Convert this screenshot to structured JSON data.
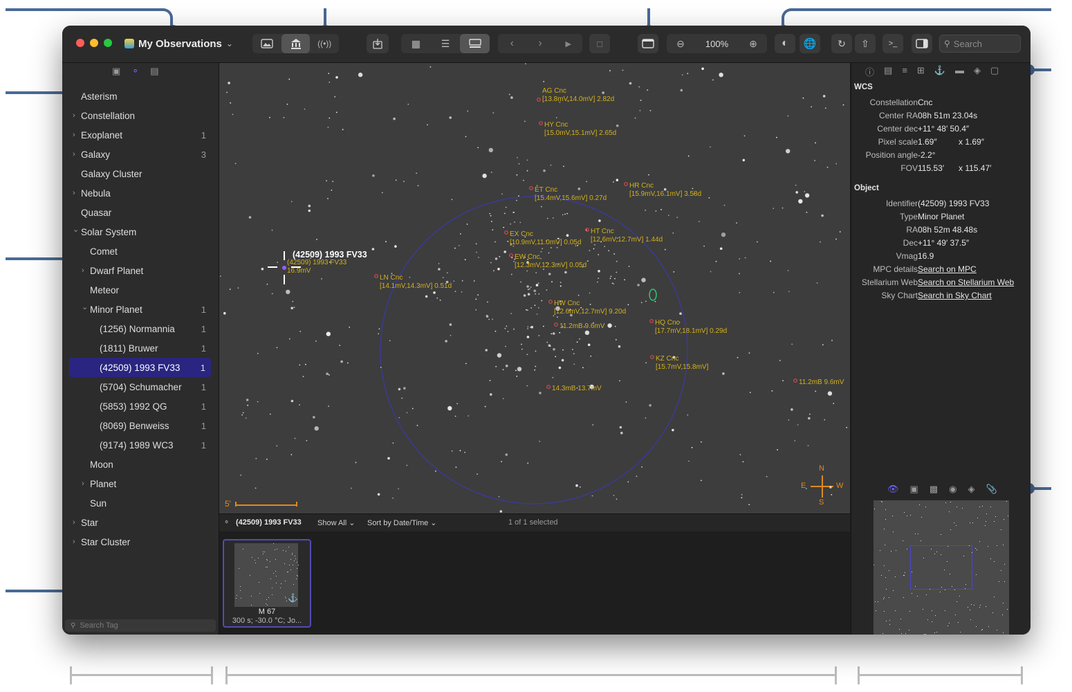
{
  "window": {
    "title": "My Observations",
    "zoom": "100%",
    "search_placeholder": "Search"
  },
  "sidebar": {
    "items": [
      {
        "label": "Asterism",
        "count": "",
        "expand": "none",
        "level": 0
      },
      {
        "label": "Constellation",
        "count": "",
        "expand": "collapsed",
        "level": 0
      },
      {
        "label": "Exoplanet",
        "count": "1",
        "expand": "collapsed",
        "level": 0
      },
      {
        "label": "Galaxy",
        "count": "3",
        "expand": "collapsed",
        "level": 0
      },
      {
        "label": "Galaxy Cluster",
        "count": "",
        "expand": "none",
        "level": 0
      },
      {
        "label": "Nebula",
        "count": "",
        "expand": "collapsed",
        "level": 0
      },
      {
        "label": "Quasar",
        "count": "",
        "expand": "none",
        "level": 0
      },
      {
        "label": "Solar System",
        "count": "",
        "expand": "expanded",
        "level": 0
      },
      {
        "label": "Comet",
        "count": "",
        "expand": "none",
        "level": 1
      },
      {
        "label": "Dwarf Planet",
        "count": "",
        "expand": "collapsed",
        "level": 1
      },
      {
        "label": "Meteor",
        "count": "",
        "expand": "none",
        "level": 1
      },
      {
        "label": "Minor Planet",
        "count": "1",
        "expand": "expanded",
        "level": 1
      },
      {
        "label": "(1256) Normannia",
        "count": "1",
        "expand": "none",
        "level": 2
      },
      {
        "label": "(1811) Bruwer",
        "count": "1",
        "expand": "none",
        "level": 2
      },
      {
        "label": "(42509) 1993 FV33",
        "count": "1",
        "expand": "none",
        "level": 2,
        "selected": true
      },
      {
        "label": "(5704) Schumacher",
        "count": "1",
        "expand": "none",
        "level": 2
      },
      {
        "label": "(5853) 1992 QG",
        "count": "1",
        "expand": "none",
        "level": 2
      },
      {
        "label": "(8069) Benweiss",
        "count": "1",
        "expand": "none",
        "level": 2
      },
      {
        "label": "(9174) 1989 WC3",
        "count": "1",
        "expand": "none",
        "level": 2
      },
      {
        "label": "Moon",
        "count": "",
        "expand": "none",
        "level": 1
      },
      {
        "label": "Planet",
        "count": "",
        "expand": "collapsed",
        "level": 1
      },
      {
        "label": "Sun",
        "count": "",
        "expand": "none",
        "level": 1
      },
      {
        "label": "Star",
        "count": "",
        "expand": "collapsed",
        "level": 0
      },
      {
        "label": "Star Cluster",
        "count": "",
        "expand": "collapsed",
        "level": 0
      }
    ],
    "search_placeholder": "Search Tag"
  },
  "sky": {
    "labels": [
      {
        "name": "AG Cnc",
        "mag": "[13.8mV,14.0mV] 2.82d"
      },
      {
        "name": "HY Cnc",
        "mag": "[15.0mV,15.1mV] 2.65d"
      },
      {
        "name": "ET Cnc",
        "mag": "[15.4mV,15.6mV] 0.27d"
      },
      {
        "name": "HR Cnc",
        "mag": "[15.9mV,16.1mV] 3.58d"
      },
      {
        "name": "EX Cnc",
        "mag": "[10.9mV,11.0mV] 0.05d"
      },
      {
        "name": "HT Cnc",
        "mag": "[12.6mV,12.7mV] 1.44d"
      },
      {
        "name": "EW Cnc",
        "mag": "[12.3mV,12.3mV] 0.05d"
      },
      {
        "name": "LN Cnc",
        "mag": "[14.1mV,14.3mV] 0.51d"
      },
      {
        "name": "HW Cnc",
        "mag": "[12.6mV,12.7mV] 9.20d"
      },
      {
        "name": "",
        "mag": "11.2mB 9.6mV"
      },
      {
        "name": "HQ Cnc",
        "mag": "[17.7mV,18.1mV] 0.29d"
      },
      {
        "name": "KZ Cnc",
        "mag": "[15.7mV,15.8mV]"
      },
      {
        "name": "",
        "mag": "14.3mB 13.7mV"
      },
      {
        "name": "",
        "mag": "11.2mB 9.6mV"
      }
    ],
    "target_title": "(42509) 1993 FV33",
    "target_sub": "(42509) 1993 FV33",
    "target_mag": "16.9mV",
    "scale_label": "5'",
    "compass": {
      "n": "N",
      "s": "S",
      "e": "E",
      "w": "W"
    }
  },
  "strip": {
    "tag": "(42509) 1993 FV33",
    "filter": "Show All",
    "sort": "Sort by Date/Time",
    "status": "1 of 1 selected"
  },
  "browser": {
    "thumb_title": "M 67",
    "thumb_sub": "300 s; -30.0 °C; Jo..."
  },
  "inspector": {
    "wcs_header": "WCS",
    "wcs": [
      {
        "k": "Constellation",
        "v": "Cnc",
        "v2": ""
      },
      {
        "k": "Center RA",
        "v": "08h 51m 23.04s",
        "v2": ""
      },
      {
        "k": "Center dec",
        "v": "+11° 48′ 50.4″",
        "v2": ""
      },
      {
        "k": "Pixel scale",
        "v": "1.69″",
        "v2": "x 1.69″"
      },
      {
        "k": "Position angle",
        "v": "-2.2°",
        "v2": ""
      },
      {
        "k": "FOV",
        "v": "115.53′",
        "v2": "x 115.47′"
      }
    ],
    "object_header": "Object",
    "object": [
      {
        "k": "Identifier",
        "v": "(42509) 1993 FV33"
      },
      {
        "k": "Type",
        "v": "Minor Planet"
      },
      {
        "k": "RA",
        "v": "08h 52m 48.48s"
      },
      {
        "k": "Dec",
        "v": "+11° 49′ 37.5″"
      },
      {
        "k": "Vmag",
        "v": "16.9"
      },
      {
        "k": "MPC details",
        "v": "Search on MPC",
        "link": true
      },
      {
        "k": "Stellarium Web",
        "v": "Search on Stellarium Web",
        "link": true
      },
      {
        "k": "Sky Chart",
        "v": "Search in Sky Chart",
        "link": true
      }
    ]
  },
  "colors": {
    "accent": "#2a2580",
    "link": "#4a90e2",
    "label": "#d4b11a",
    "callout": "#4a6a96"
  }
}
